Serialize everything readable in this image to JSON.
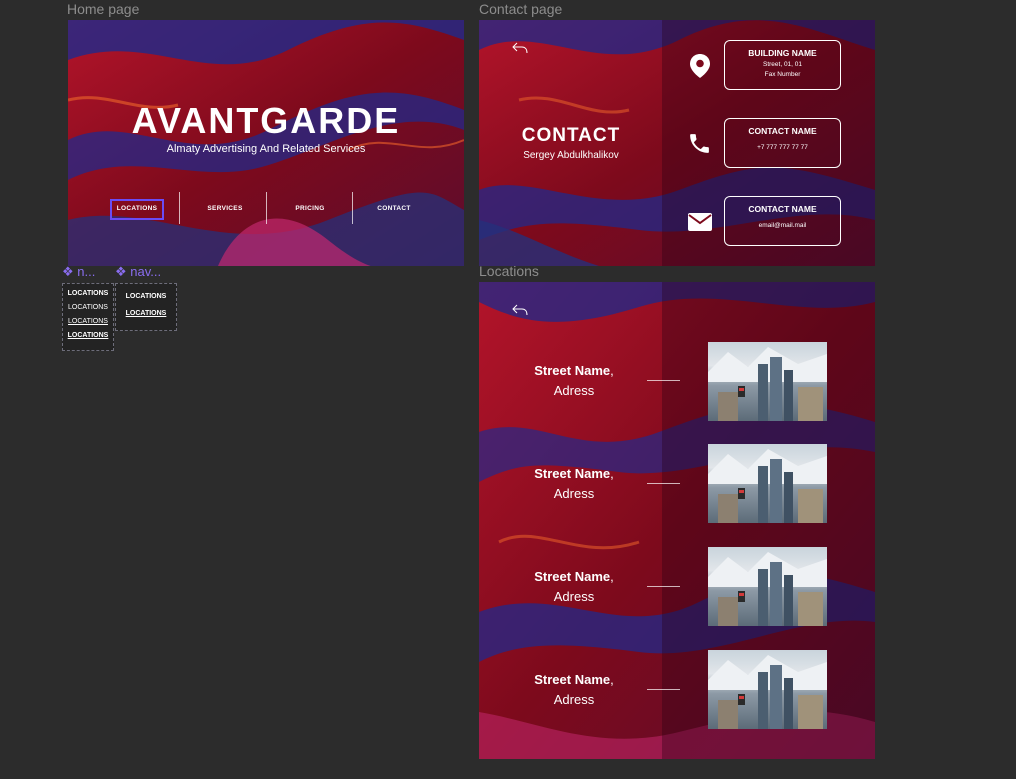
{
  "frames": {
    "home_label": "Home page",
    "contact_label": "Contact page",
    "locations_label": "Locations"
  },
  "home": {
    "title": "AVANTGARDE",
    "subtitle": "Almaty Advertising And Related Services",
    "nav": [
      "LOCATIONS",
      "SERVICES",
      "PRICING",
      "CONTACT"
    ]
  },
  "contact": {
    "title": "CONTACT",
    "name": "Sergey Abdulkhalikov",
    "cards": [
      {
        "icon": "location-pin-icon",
        "title": "BUILDING NAME",
        "line1": "Street, 01, 01",
        "line2": "Fax Number"
      },
      {
        "icon": "phone-icon",
        "title": "CONTACT NAME",
        "line1": "+7 777 777 77 77",
        "line2": ""
      },
      {
        "icon": "mail-icon",
        "title": "CONTACT NAME",
        "line1": "email@mail.mail",
        "line2": ""
      }
    ]
  },
  "locations": {
    "items": [
      {
        "name": "Street Name",
        "address": "Adress"
      },
      {
        "name": "Street Name",
        "address": "Adress"
      },
      {
        "name": "Street Name",
        "address": "Adress"
      },
      {
        "name": "Street Name",
        "address": "Adress"
      }
    ]
  },
  "components": {
    "comp1_label": "n...",
    "comp2_label": "nav...",
    "comp1_items": [
      "LOCATIONS",
      "LOCATIONS",
      "LOCATIONS",
      "LOCATIONS"
    ],
    "comp2_items": [
      "LOCATIONS",
      "LOCATIONS"
    ]
  },
  "colors": {
    "accent": "#6a4cf5",
    "canvas": "#2c2c2c",
    "frame_red": "#8a0f1f"
  }
}
